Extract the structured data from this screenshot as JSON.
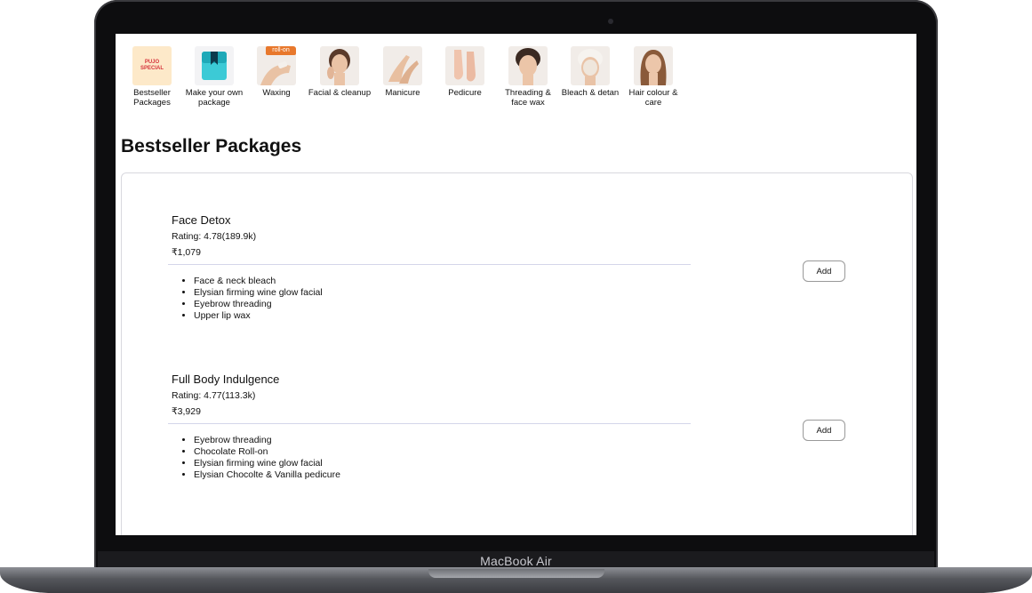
{
  "device": {
    "label": "MacBook Air"
  },
  "categories": [
    {
      "label": "Bestseller Packages",
      "thumb_text": "PUJO SPECIAL",
      "icon": "pujo-special-badge"
    },
    {
      "label": "Make your own package",
      "icon": "package-box-icon"
    },
    {
      "label": "Waxing",
      "tag": "roll-on",
      "icon": "waxing-photo"
    },
    {
      "label": "Facial & cleanup",
      "icon": "facial-photo"
    },
    {
      "label": "Manicure",
      "icon": "manicure-photo"
    },
    {
      "label": "Pedicure",
      "icon": "pedicure-photo"
    },
    {
      "label": "Threading & face wax",
      "icon": "threading-photo"
    },
    {
      "label": "Bleach & detan",
      "icon": "bleach-photo"
    },
    {
      "label": "Hair colour & care",
      "icon": "hair-colour-photo"
    }
  ],
  "section": {
    "title": "Bestseller Packages"
  },
  "packages": [
    {
      "name": "Face Detox",
      "rating": "Rating: 4.78(189.9k)",
      "price": "₹1,079",
      "items": [
        "Face & neck bleach",
        "Elysian firming wine glow facial",
        "Eyebrow threading",
        "Upper lip wax"
      ],
      "add_label": "Add"
    },
    {
      "name": "Full Body Indulgence",
      "rating": "Rating: 4.77(113.3k)",
      "price": "₹3,929",
      "items": [
        "Eyebrow threading",
        "Chocolate Roll-on",
        "Elysian firming wine glow facial",
        "Elysian Chocolte & Vanilla pedicure"
      ],
      "add_label": "Add"
    }
  ],
  "colors": {
    "accent_tag": "#e8782c",
    "pujo_bg": "#fde9c9",
    "pujo_text": "#d6343c",
    "divider": "#d4d6ea"
  }
}
